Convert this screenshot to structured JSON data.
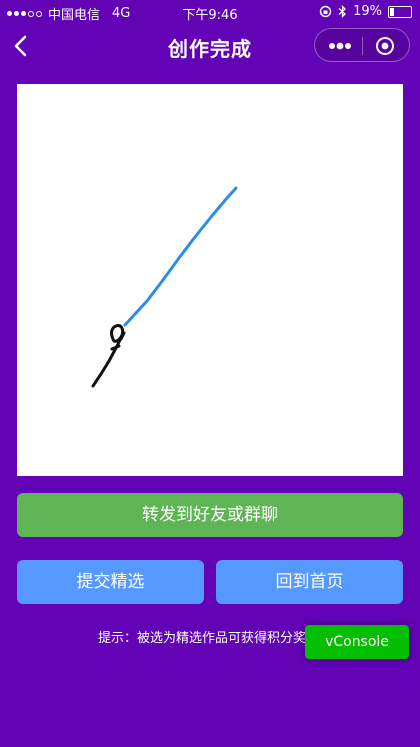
{
  "status_bar": {
    "carrier": "中国电信",
    "network": "4G",
    "time": "下午9:46",
    "battery": "19%",
    "icons": [
      "signal-icon",
      "orientation-lock-icon",
      "bluetooth-icon",
      "battery-icon"
    ]
  },
  "nav": {
    "title": "创作完成",
    "icons": [
      "back-icon",
      "more-icon",
      "record-icon"
    ]
  },
  "canvas": {
    "stroke_colors": {
      "blue": "#2a8de6",
      "black": "#111111"
    }
  },
  "actions": {
    "share_label": "转发到好友或群聊",
    "submit_label": "提交精选",
    "home_label": "回到首页"
  },
  "tip": "提示：被选为精选作品可获得积分奖",
  "vconsole_label": "vConsole",
  "colors": {
    "background": "#6204b6",
    "share_button": "#5fb555",
    "primary_button": "#5599ff",
    "vconsole": "#04be02"
  }
}
